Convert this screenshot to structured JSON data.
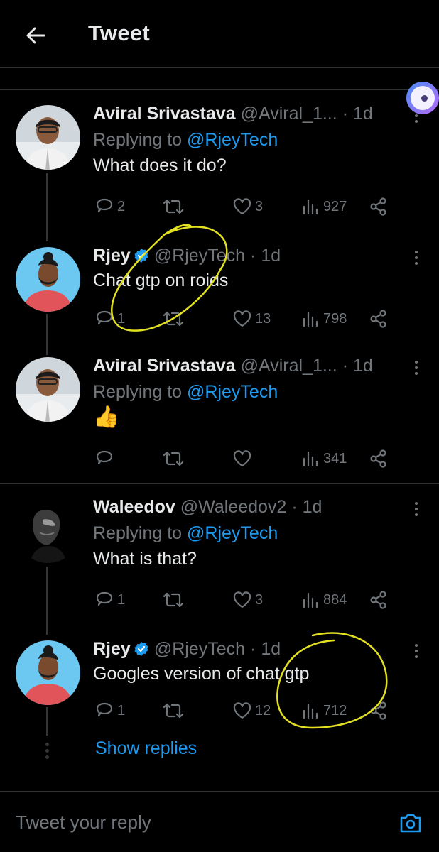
{
  "header": {
    "title": "Tweet"
  },
  "tweets": [
    {
      "name": "Aviral Srivastava",
      "handle": "@Aviral_1...",
      "time": "1d",
      "verified": false,
      "replying_prefix": "Replying to ",
      "replying_to": "@RjeyTech",
      "text": "What does it do?",
      "replies": "2",
      "retweets": "",
      "likes": "3",
      "views": "927"
    },
    {
      "name": "Rjey",
      "handle": "@RjeyTech",
      "time": "1d",
      "verified": true,
      "replying_prefix": "",
      "replying_to": "",
      "text": "Chat gtp on roids",
      "replies": "1",
      "retweets": "",
      "likes": "13",
      "views": "798"
    },
    {
      "name": "Aviral Srivastava",
      "handle": "@Aviral_1...",
      "time": "1d",
      "verified": false,
      "replying_prefix": "Replying to ",
      "replying_to": "@RjeyTech",
      "text": "👍",
      "replies": "",
      "retweets": "",
      "likes": "",
      "views": "341"
    },
    {
      "name": "Waleedov",
      "handle": "@Waleedov2",
      "time": "1d",
      "verified": false,
      "replying_prefix": "Replying to ",
      "replying_to": "@RjeyTech",
      "text": "What is that?",
      "replies": "1",
      "retweets": "",
      "likes": "3",
      "views": "884"
    },
    {
      "name": "Rjey",
      "handle": "@RjeyTech",
      "time": "1d",
      "verified": true,
      "replying_prefix": "",
      "replying_to": "",
      "text": "Googles version of chat gtp",
      "replies": "1",
      "retweets": "",
      "likes": "12",
      "views": "712"
    }
  ],
  "show_replies": "Show replies",
  "reply_bar": {
    "placeholder": "Tweet your reply"
  },
  "separator": "·",
  "colors": {
    "accent": "#1d9bf0",
    "muted": "#71767b",
    "text": "#e7e9ea",
    "background": "#000000",
    "annotation": "#e3e022"
  },
  "icons": [
    "back-arrow-icon",
    "reply-icon",
    "retweet-icon",
    "like-icon",
    "views-icon",
    "share-icon",
    "more-icon",
    "verified-badge-icon",
    "camera-icon"
  ]
}
